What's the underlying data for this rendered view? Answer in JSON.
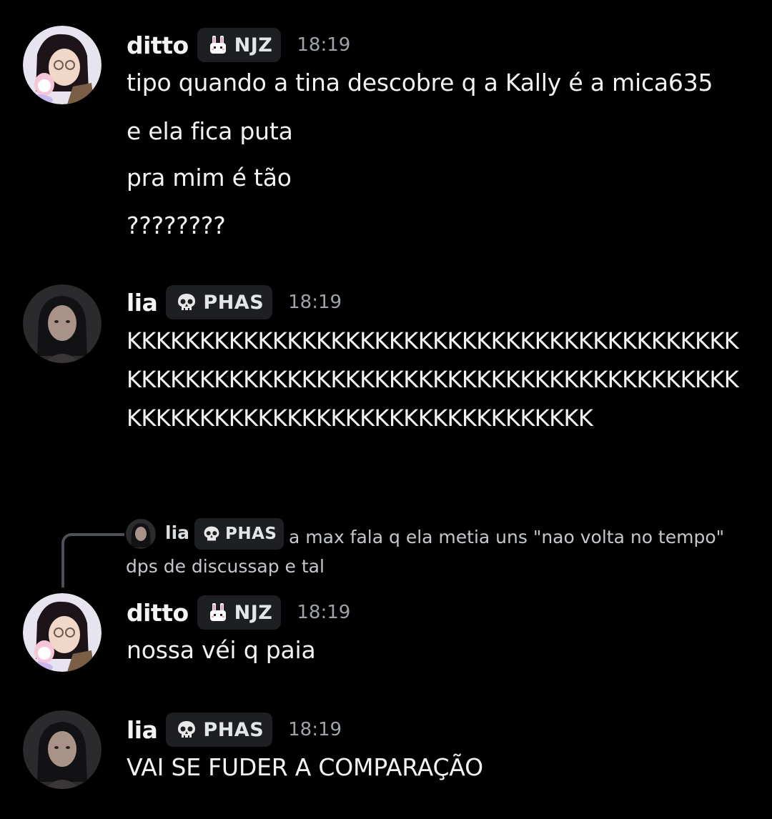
{
  "messages": [
    {
      "username": "ditto",
      "tag": "NJZ",
      "tag_icon": "bunny-icon",
      "time": "18:19",
      "lines": [
        "tipo quando a tina descobre q a Kally é a mica635",
        "e ela fica puta",
        "pra mim é tão",
        "????????"
      ]
    },
    {
      "username": "lia",
      "tag": "PHAS",
      "tag_icon": "skull-icon",
      "time": "18:19",
      "text": "KKKKKKKKKKKKKKKKKKKKKKKKKKKKKKKKKKKKKKKKKKKKKKKKKKKKKKKKKKKKKKKKKKKKKKKKKKKKKKKKKKKKKKKKKKKKKKKKKKKKKKKKKKKKKKKKKKKK"
    },
    {
      "reply": {
        "username": "lia",
        "tag": "PHAS",
        "text": "a max fala q ela metia uns \"nao volta no tempo\" dps de discussap e tal"
      },
      "username": "ditto",
      "tag": "NJZ",
      "tag_icon": "bunny-icon",
      "time": "18:19",
      "text": "nossa véi q paia"
    },
    {
      "username": "lia",
      "tag": "PHAS",
      "tag_icon": "skull-icon",
      "time": "18:19",
      "text": "VAI SE FUDER A COMPARAÇÃO"
    }
  ]
}
